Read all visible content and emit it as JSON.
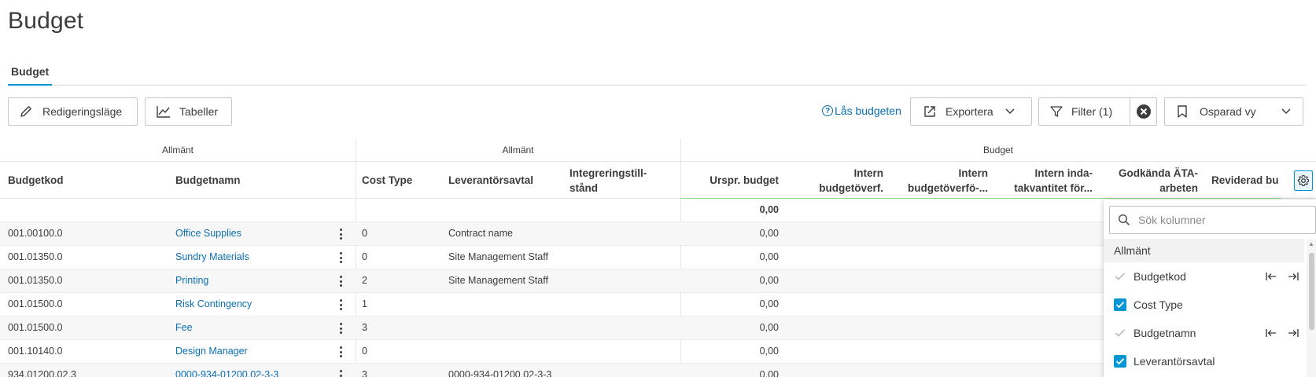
{
  "page": {
    "title": "Budget"
  },
  "tabs": [
    {
      "label": "Budget"
    }
  ],
  "toolbar": {
    "edit_mode": "Redigeringsläge",
    "tables": "Tabeller",
    "lock_budget": "Lås budgeten",
    "lock_icon_glyph": "?",
    "export": "Exportera",
    "filter": "Filter (1)",
    "saved_view": "Osparad vy"
  },
  "grid": {
    "groups": [
      "Allmänt",
      "Allmänt",
      "Budget"
    ],
    "columns": {
      "budgetkod": "Budgetkod",
      "budgetnamn": "Budgetnamn",
      "cost_type": "Cost Type",
      "leverantorsavtal": "Leverantörsavtal",
      "integrering_1": "Integreringstill-",
      "integrering_2": "stånd",
      "urspr_budget": "Urspr. budget",
      "intern_overf_1": "Intern",
      "intern_overf_2": "budgetöverf.",
      "intern_overf2_1": "Intern",
      "intern_overf2_2": "budgetöverfö-...",
      "intern_inda_1": "Intern inda-",
      "intern_inda_2": "takvantitet för...",
      "godkanda_1": "Godkända ÄTA-",
      "godkanda_2": "arbeten",
      "reviderad": "Reviderad bu"
    },
    "total_row": {
      "urspr_budget": "0,00"
    },
    "rows": [
      {
        "code": "001.00100.0",
        "name": "Office Supplies",
        "cost_type": "0",
        "supplier": "Contract name",
        "budget": "0,00"
      },
      {
        "code": "001.01350.0",
        "name": "Sundry Materials",
        "cost_type": "0",
        "supplier": "Site Management Staff",
        "budget": "0,00"
      },
      {
        "code": "001.01350.0",
        "name": "Printing",
        "cost_type": "2",
        "supplier": "Site Management Staff",
        "budget": "0,00"
      },
      {
        "code": "001.01500.0",
        "name": "Risk Contingency",
        "cost_type": "1",
        "supplier": "",
        "budget": "0,00"
      },
      {
        "code": "001.01500.0",
        "name": "Fee",
        "cost_type": "3",
        "supplier": "",
        "budget": "0,00"
      },
      {
        "code": "001.10140.0",
        "name": "Design Manager",
        "cost_type": "0",
        "supplier": "",
        "budget": "0,00"
      },
      {
        "code": "934.01200.02.3",
        "name": "0000-934-01200.02-3-3",
        "cost_type": "3",
        "supplier": "0000-934-01200.02-3-3",
        "budget": "0,00"
      }
    ]
  },
  "column_picker": {
    "search_placeholder": "Sök kolumner",
    "section": "Allmänt",
    "options": [
      {
        "label": "Budgetkod",
        "state": "disabled-checked",
        "pinnable": true
      },
      {
        "label": "Cost Type",
        "state": "checked",
        "pinnable": false
      },
      {
        "label": "Budgetnamn",
        "state": "disabled-checked",
        "pinnable": true
      },
      {
        "label": "Leverantörsavtal",
        "state": "checked",
        "pinnable": false
      }
    ]
  },
  "colors": {
    "accent": "#0696d7",
    "link": "#0a6fb2",
    "border": "#c7c7c7",
    "green_indicator": "#8fd98f"
  }
}
